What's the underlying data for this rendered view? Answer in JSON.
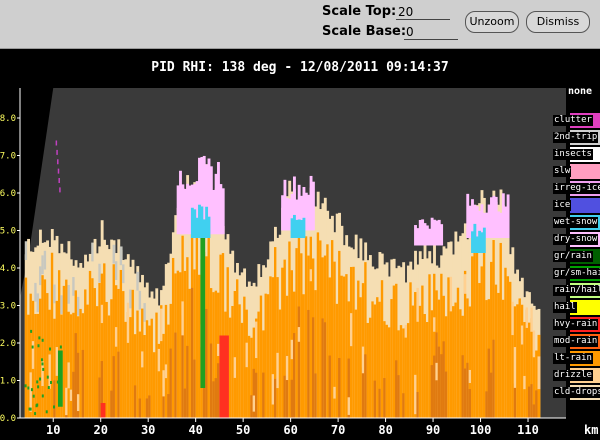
{
  "toolbar": {
    "scale_top_label": "Scale Top:",
    "scale_top_value": "20",
    "scale_base_label": "Scale Base:",
    "scale_base_value": "0",
    "unzoom_label": "Unzoom",
    "dismiss_label": "Dismiss"
  },
  "plot_title": "PID  RHI: 138 deg  -  12/08/2011 09:14:37",
  "legend": {
    "header": "none",
    "items": [
      {
        "label": "clutter",
        "color": "#e040c0"
      },
      {
        "label": "2nd-trip",
        "color": "#d0d0d0"
      },
      {
        "label": "insects",
        "color": "#ffffff"
      },
      {
        "label": "slw",
        "color": "#ff9ec0"
      },
      {
        "label": "irreg-ice",
        "color": "#f0a0f0"
      },
      {
        "label": "ice",
        "color": "#5050e0"
      },
      {
        "label": "wet-snow",
        "color": "#40d0f0"
      },
      {
        "label": "dry-snow",
        "color": "#ffc0ff"
      },
      {
        "label": "gr/rain",
        "color": "#006000"
      },
      {
        "label": "gr/sm-hail",
        "color": "#00a000"
      },
      {
        "label": "rain/hail",
        "color": "#c0ff80"
      },
      {
        "label": "hail",
        "color": "#ffff00"
      },
      {
        "label": "hvy-rain",
        "color": "#ff2020"
      },
      {
        "label": "mod-rain",
        "color": "#ff6010"
      },
      {
        "label": "lt-rain",
        "color": "#ff9a00"
      },
      {
        "label": "drizzle",
        "color": "#ffd090"
      },
      {
        "label": "cld-drops",
        "color": "#f5deb3"
      }
    ]
  },
  "chart_data": {
    "type": "heatmap",
    "x_ticks": [
      "10",
      "20",
      "30",
      "40",
      "50",
      "60",
      "70",
      "80",
      "90",
      "100",
      "110"
    ],
    "y_ticks": [
      "0.0",
      "1.0",
      "2.0",
      "3.0",
      "4.0",
      "5.0",
      "6.0",
      "7.0",
      "8.0"
    ],
    "x_unit_fragment": "km",
    "xlim": [
      3,
      118
    ],
    "ylim": [
      0,
      8.8
    ],
    "colors": {
      "background": "#3a3a3a",
      "cld_drops": "#f5deb3",
      "drizzle": "#ffd090",
      "lt_rain": "#ff9a00",
      "mod_rain": "#e07a10",
      "hvy_rain": "#ff3020",
      "dry_snow": "#ffc0ff",
      "wet_snow": "#40d0f0",
      "gr_sm_hail": "#20a020",
      "second_trip": "#c8c8c0"
    },
    "echo_tops_km": [
      [
        4,
        4.9
      ],
      [
        8,
        5.0
      ],
      [
        12,
        4.9
      ],
      [
        16,
        4.2
      ],
      [
        20,
        5.2
      ],
      [
        24,
        4.8
      ],
      [
        28,
        3.9
      ],
      [
        32,
        3.4
      ],
      [
        36,
        5.8
      ],
      [
        38,
        6.6
      ],
      [
        40,
        6.1
      ],
      [
        42,
        7.0
      ],
      [
        44,
        6.0
      ],
      [
        46,
        5.4
      ],
      [
        48,
        4.2
      ],
      [
        52,
        3.8
      ],
      [
        56,
        4.8
      ],
      [
        60,
        6.5
      ],
      [
        62,
        5.9
      ],
      [
        66,
        6.2
      ],
      [
        70,
        5.4
      ],
      [
        72,
        5.0
      ],
      [
        76,
        4.6
      ],
      [
        80,
        4.3
      ],
      [
        84,
        4.1
      ],
      [
        88,
        4.7
      ],
      [
        92,
        4.5
      ],
      [
        96,
        5.2
      ],
      [
        100,
        6.0
      ],
      [
        104,
        6.0
      ],
      [
        108,
        3.8
      ],
      [
        112,
        3.0
      ]
    ],
    "ice_layers": [
      {
        "class": "dry_snow",
        "x0": 36,
        "x1": 46,
        "bottom": 4.9,
        "top": 7.0
      },
      {
        "class": "wet_snow",
        "x0": 39,
        "x1": 43,
        "bottom": 4.8,
        "top": 5.7
      },
      {
        "class": "dry_snow",
        "x0": 58,
        "x1": 65,
        "bottom": 5.0,
        "top": 6.5
      },
      {
        "class": "wet_snow",
        "x0": 60,
        "x1": 63,
        "bottom": 4.8,
        "top": 5.5
      },
      {
        "class": "dry_snow",
        "x0": 86,
        "x1": 92,
        "bottom": 4.6,
        "top": 5.4
      },
      {
        "class": "dry_snow",
        "x0": 97,
        "x1": 106,
        "bottom": 4.8,
        "top": 6.0
      },
      {
        "class": "wet_snow",
        "x0": 98,
        "x1": 101,
        "bottom": 4.4,
        "top": 5.2
      }
    ],
    "cores": [
      {
        "class": "gr_sm_hail",
        "x0": 41,
        "x1": 42,
        "bottom": 0.8,
        "top": 4.8
      },
      {
        "class": "gr_sm_hail",
        "x0": 11,
        "x1": 12,
        "bottom": 0.3,
        "top": 1.8
      },
      {
        "class": "hvy_rain",
        "x0": 45,
        "x1": 47,
        "bottom": 0.0,
        "top": 2.2
      },
      {
        "class": "hvy_rain",
        "x0": 20,
        "x1": 21,
        "bottom": 0.0,
        "top": 0.4
      }
    ]
  }
}
